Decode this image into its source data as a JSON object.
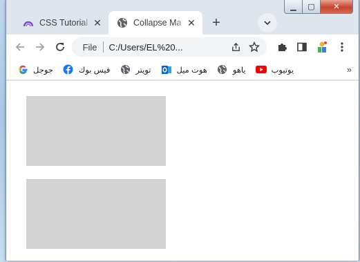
{
  "window": {
    "caption": {
      "minimize_glyph": "▁",
      "maximize_glyph": "▢",
      "close_glyph": "✕"
    }
  },
  "tabs": [
    {
      "title": "CSS Tutorial",
      "icon": "arc-logo-icon",
      "active": false
    },
    {
      "title": "Collapse Ma",
      "icon": "globe-icon",
      "active": true
    }
  ],
  "tab_close_glyph": "✕",
  "new_tab_glyph": "+",
  "toolbar": {
    "omnibox": {
      "scheme_label": "File",
      "url": "C:/Users/EL%20..."
    }
  },
  "bookmarks": [
    {
      "label": "جوجل",
      "icon": "google-icon"
    },
    {
      "label": "فيس بوك",
      "icon": "facebook-icon"
    },
    {
      "label": "تويتر",
      "icon": "globe-icon"
    },
    {
      "label": "هوت ميل",
      "icon": "outlook-icon"
    },
    {
      "label": "ياهو",
      "icon": "globe-icon"
    },
    {
      "label": "يوتيوب",
      "icon": "youtube-icon"
    }
  ],
  "bookmarks_more_glyph": "»",
  "colors": {
    "box_fill": "#d3d3d3",
    "youtube_red": "#ff0000",
    "facebook_blue": "#1877f2",
    "outlook_blue": "#0a64c8",
    "arc_purple": "#7b4ddb"
  },
  "page": {
    "boxes": [
      {
        "name": "box-1"
      },
      {
        "name": "box-2"
      }
    ]
  }
}
